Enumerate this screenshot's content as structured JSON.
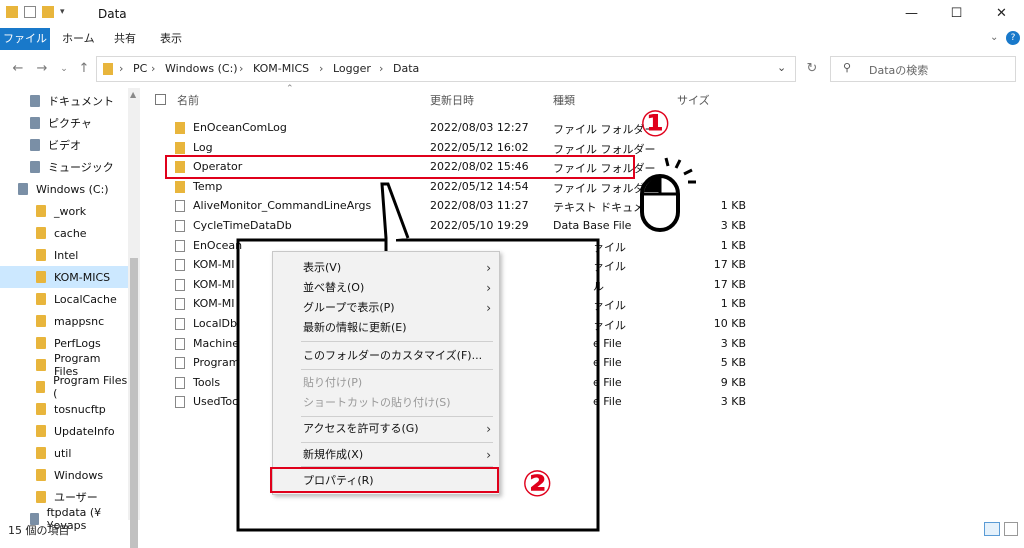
{
  "window": {
    "title": "Data",
    "minimize": "—",
    "maximize": "☐",
    "close": "✕"
  },
  "ribbon": {
    "tabs": [
      "ファイル",
      "ホーム",
      "共有",
      "表示"
    ]
  },
  "address": {
    "crumbs": [
      "PC",
      "Windows (C:)",
      "KOM-MICS",
      "Logger",
      "Data"
    ]
  },
  "search": {
    "placeholder": "Dataの検索"
  },
  "sidebar": {
    "items": [
      {
        "label": "ドキュメント"
      },
      {
        "label": "ピクチャ"
      },
      {
        "label": "ビデオ"
      },
      {
        "label": "ミュージック"
      },
      {
        "label": "Windows (C:)"
      },
      {
        "label": "_work"
      },
      {
        "label": "cache"
      },
      {
        "label": "Intel"
      },
      {
        "label": "KOM-MICS"
      },
      {
        "label": "LocalCache"
      },
      {
        "label": "mappsnc"
      },
      {
        "label": "PerfLogs"
      },
      {
        "label": "Program Files"
      },
      {
        "label": "Program Files ("
      },
      {
        "label": "tosnucftp"
      },
      {
        "label": "UpdateInfo"
      },
      {
        "label": "util"
      },
      {
        "label": "Windows"
      },
      {
        "label": "ユーザー"
      },
      {
        "label": "ftpdata (¥¥ovaps"
      }
    ]
  },
  "columns": {
    "name": "名前",
    "date": "更新日時",
    "type": "種類",
    "size": "サイズ"
  },
  "files": [
    {
      "name": "EnOceanComLog",
      "date": "2022/08/03 12:27",
      "type": "ファイル フォルダー",
      "size": ""
    },
    {
      "name": "Log",
      "date": "2022/05/12 16:02",
      "type": "ファイル フォルダー",
      "size": ""
    },
    {
      "name": "Operator",
      "date": "2022/08/02 15:46",
      "type": "ファイル フォルダー",
      "size": ""
    },
    {
      "name": "Temp",
      "date": "2022/05/12 14:54",
      "type": "ファイル フォルダー",
      "size": ""
    },
    {
      "name": "AliveMonitor_CommandLineArgs",
      "date": "2022/08/03 11:27",
      "type": "テキスト ドキュメント",
      "size": "1 KB"
    },
    {
      "name": "CycleTimeDataDb",
      "date": "2022/05/10 19:29",
      "type": "Data Base File",
      "size": "3 KB"
    },
    {
      "name": "EnOcean",
      "date": "",
      "type": "ァイル",
      "size": "1 KB"
    },
    {
      "name": "KOM-MI",
      "date": "",
      "type": "ァイル",
      "size": "17 KB"
    },
    {
      "name": "KOM-MI",
      "date": "",
      "type": "ル",
      "size": "17 KB"
    },
    {
      "name": "KOM-MI",
      "date": "",
      "type": "ァイル",
      "size": "1 KB"
    },
    {
      "name": "LocalDb",
      "date": "",
      "type": "ァイル",
      "size": "10 KB"
    },
    {
      "name": "Machine",
      "date": "",
      "type": "e File",
      "size": "3 KB"
    },
    {
      "name": "Program",
      "date": "",
      "type": "e File",
      "size": "5 KB"
    },
    {
      "name": "Tools",
      "date": "",
      "type": "e File",
      "size": "9 KB"
    },
    {
      "name": "UsedToo",
      "date": "",
      "type": "e File",
      "size": "3 KB"
    }
  ],
  "context_menu": [
    {
      "label": "表示(V)",
      "sub": "›"
    },
    {
      "label": "並べ替え(O)",
      "sub": "›"
    },
    {
      "label": "グループで表示(P)",
      "sub": "›"
    },
    {
      "label": "最新の情報に更新(E)",
      "sub": ""
    },
    {
      "label": "このフォルダーのカスタマイズ(F)...",
      "sub": ""
    },
    {
      "label": "貼り付け(P)",
      "sub": ""
    },
    {
      "label": "ショートカットの貼り付け(S)",
      "sub": ""
    },
    {
      "label": "アクセスを許可する(G)",
      "sub": "›"
    },
    {
      "label": "新規作成(X)",
      "sub": "›"
    },
    {
      "label": "プロパティ(R)",
      "sub": ""
    }
  ],
  "annotations": {
    "step1": "①",
    "step2": "②"
  },
  "status": {
    "count": "15 個の項目"
  },
  "colors": {
    "accent": "#1979ca",
    "highlight": "#e0001b",
    "selected": "#cce8ff"
  }
}
